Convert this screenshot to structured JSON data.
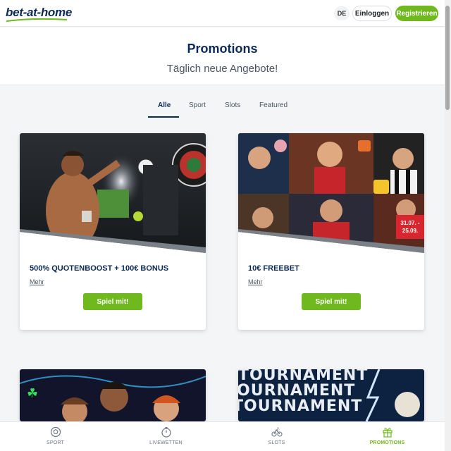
{
  "header": {
    "logo": "bet-at-home",
    "lang": "DE",
    "login": "Einloggen",
    "register": "Registrieren"
  },
  "hero": {
    "title": "Promotions",
    "subtitle": "Täglich neue Angebote!"
  },
  "tabs": [
    {
      "label": "Alle",
      "active": true
    },
    {
      "label": "Sport"
    },
    {
      "label": "Slots"
    },
    {
      "label": "Featured"
    }
  ],
  "promotions": [
    {
      "title": "500% QUOTENBOOST + 100€ BONUS",
      "more": "Mehr",
      "cta": "Spiel mit!"
    },
    {
      "title": "10€ FREEBET",
      "more": "Mehr",
      "cta": "Spiel mit!",
      "badge_line1": "31.07. -",
      "badge_line2": "25.09."
    },
    {
      "banner_text": "TOURNAMENT"
    }
  ],
  "bottom_nav": [
    {
      "label": "SPORT",
      "icon": "soccer-ball-icon"
    },
    {
      "label": "LIVEWETTEN",
      "icon": "stopwatch-icon"
    },
    {
      "label": "SLOTS",
      "icon": "slot-machine-icon"
    },
    {
      "label": "PROMOTIONS",
      "icon": "gift-icon",
      "active": true
    }
  ],
  "colors": {
    "brand_navy": "#0d2a57",
    "brand_green": "#6fb91f",
    "badge_red": "#d8262e"
  }
}
